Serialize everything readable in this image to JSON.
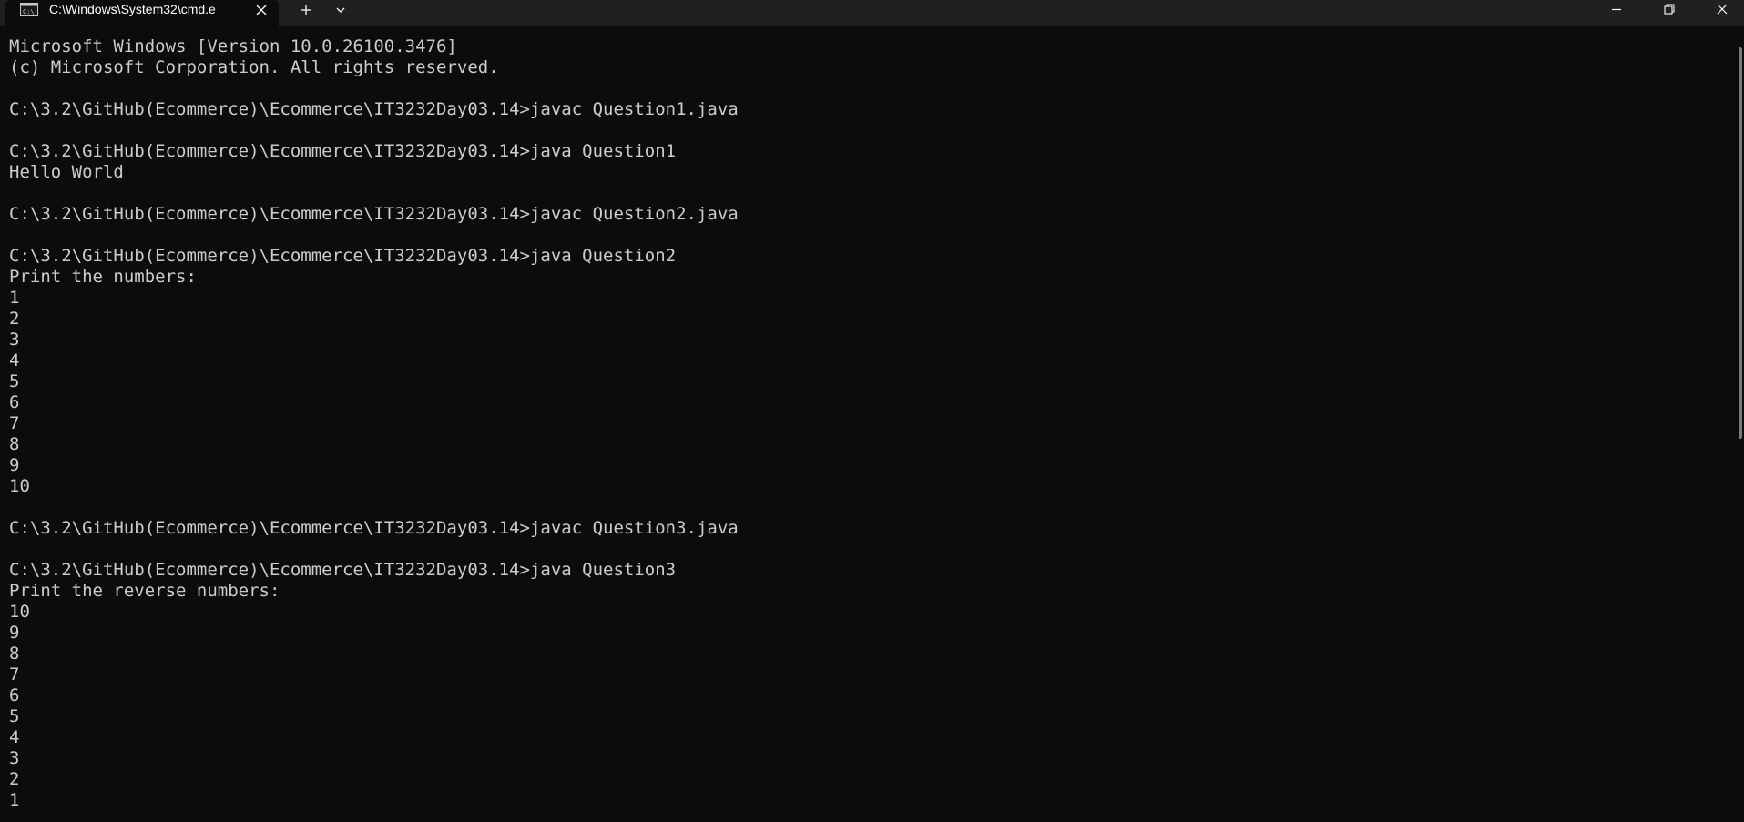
{
  "window": {
    "tab_title": "C:\\Windows\\System32\\cmd.e",
    "new_tab_icon": "plus-icon",
    "dropdown_icon": "chevron-down-icon",
    "controls": [
      "minimize-icon",
      "restore-icon",
      "close-icon"
    ]
  },
  "console": {
    "lines": [
      "Microsoft Windows [Version 10.0.26100.3476]",
      "(c) Microsoft Corporation. All rights reserved.",
      "",
      "C:\\3.2\\GitHub(Ecommerce)\\Ecommerce\\IT3232Day03.14>javac Question1.java",
      "",
      "C:\\3.2\\GitHub(Ecommerce)\\Ecommerce\\IT3232Day03.14>java Question1",
      "Hello World",
      "",
      "C:\\3.2\\GitHub(Ecommerce)\\Ecommerce\\IT3232Day03.14>javac Question2.java",
      "",
      "C:\\3.2\\GitHub(Ecommerce)\\Ecommerce\\IT3232Day03.14>java Question2",
      "Print the numbers:",
      "1",
      "2",
      "3",
      "4",
      "5",
      "6",
      "7",
      "8",
      "9",
      "10",
      "",
      "C:\\3.2\\GitHub(Ecommerce)\\Ecommerce\\IT3232Day03.14>javac Question3.java",
      "",
      "C:\\3.2\\GitHub(Ecommerce)\\Ecommerce\\IT3232Day03.14>java Question3",
      "Print the reverse numbers:",
      "10",
      "9",
      "8",
      "7",
      "6",
      "5",
      "4",
      "3",
      "2",
      "1"
    ]
  },
  "colors": {
    "background": "#0c0c0c",
    "titlebar": "#202020",
    "text": "#cccccc"
  }
}
